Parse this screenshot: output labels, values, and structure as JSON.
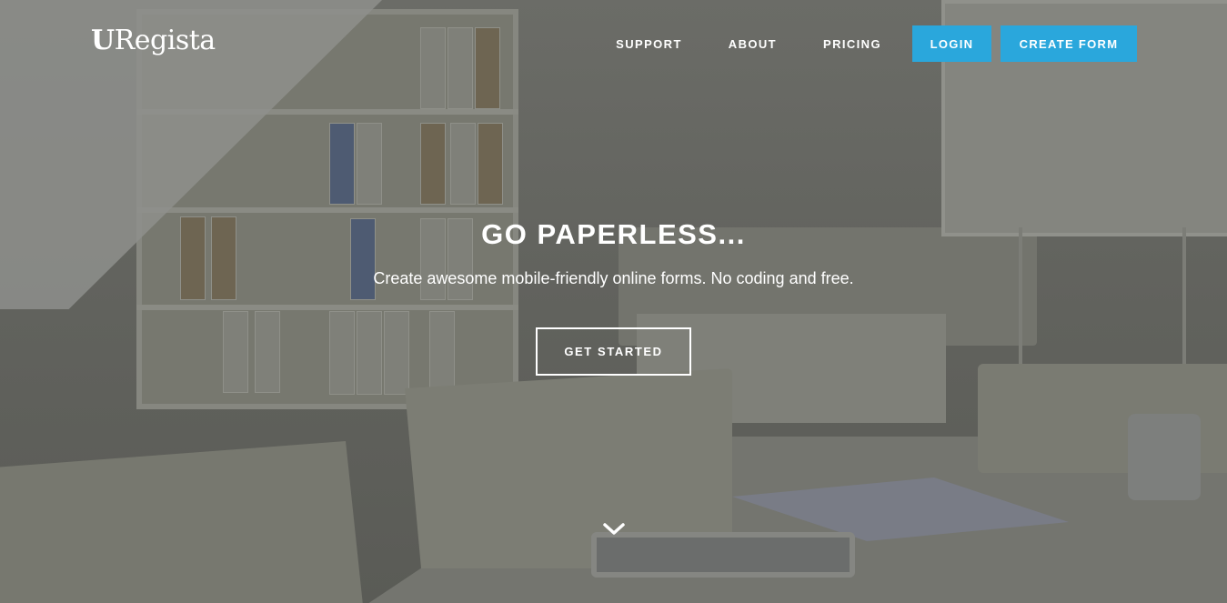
{
  "brand": {
    "logo_mark": "U",
    "logo_text": "Regista"
  },
  "nav": {
    "links": [
      "SUPPORT",
      "ABOUT",
      "PRICING"
    ],
    "login_label": "LOGIN",
    "create_label": "CREATE FORM",
    "accent_color": "#2aa7dc"
  },
  "hero": {
    "headline": "GO PAPERLESS...",
    "subline": "Create awesome mobile-friendly online forms. No coding and free.",
    "cta_label": "GET STARTED",
    "scroll_icon": "chevron-down-icon"
  }
}
